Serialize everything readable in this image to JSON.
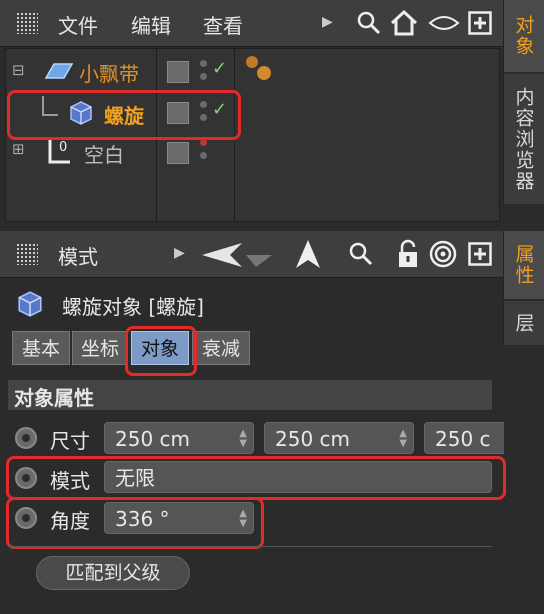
{
  "top_menu": {
    "file": "文件",
    "edit": "编辑",
    "view": "查看"
  },
  "right_tabs_top": {
    "objects": "对象",
    "content_browser": "内容浏览器"
  },
  "right_tabs_bottom": {
    "attributes": "属性",
    "layers": "层"
  },
  "objects": [
    {
      "name": "小飘带",
      "color": "#e0902a"
    },
    {
      "name": "螺旋",
      "color": "#f0a020"
    },
    {
      "name": "空白",
      "color": "#bdbdbd"
    }
  ],
  "attr_toolbar": {
    "mode": "模式"
  },
  "attr_header": {
    "title": "螺旋对象 [螺旋]"
  },
  "tabs": [
    "基本",
    "坐标",
    "对象",
    "衰减"
  ],
  "section": {
    "title": "对象属性"
  },
  "size": {
    "label": "尺寸",
    "values": [
      "250 cm",
      "250 cm",
      "250 c"
    ]
  },
  "mode": {
    "label": "模式",
    "value": "无限"
  },
  "angle": {
    "label": "角度",
    "value": "336 °"
  },
  "fit_button": {
    "label": "匹配到父级"
  },
  "colors": {
    "accent": "#f0a020",
    "highlight": "#e12a2a",
    "check": "#7fd07f"
  }
}
